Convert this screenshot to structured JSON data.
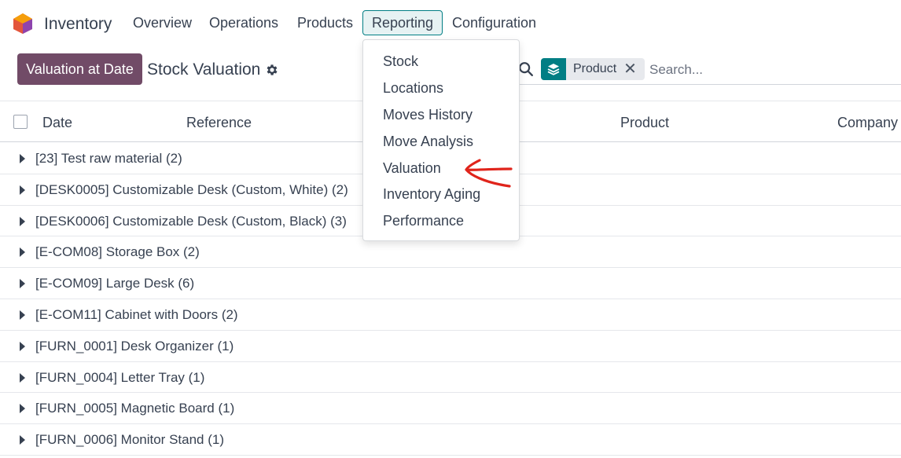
{
  "app": {
    "name": "Inventory",
    "brand_color": "#714b67",
    "accent_color": "#017e84"
  },
  "nav": {
    "items": [
      {
        "label": "Overview"
      },
      {
        "label": "Operations"
      },
      {
        "label": "Products"
      },
      {
        "label": "Reporting",
        "active": true
      },
      {
        "label": "Configuration"
      }
    ]
  },
  "reporting_menu": {
    "items": [
      {
        "label": "Stock"
      },
      {
        "label": "Locations"
      },
      {
        "label": "Moves History"
      },
      {
        "label": "Move Analysis"
      },
      {
        "label": "Valuation"
      },
      {
        "label": "Inventory Aging"
      },
      {
        "label": "Performance"
      }
    ]
  },
  "control_panel": {
    "primary_button": "Valuation at Date",
    "title": "Stock Valuation",
    "settings_icon": "gear-icon"
  },
  "search": {
    "facet_icon": "layers-icon",
    "facet_label": "Product",
    "facet_close": "✕",
    "placeholder": "Search..."
  },
  "table": {
    "columns": [
      "Date",
      "Reference",
      "Product",
      "Company"
    ],
    "groups": [
      {
        "label": "[23] Test raw material (2)"
      },
      {
        "label": "[DESK0005] Customizable Desk (Custom, White) (2)"
      },
      {
        "label": "[DESK0006] Customizable Desk (Custom, Black) (3)"
      },
      {
        "label": "[E-COM08] Storage Box (2)"
      },
      {
        "label": "[E-COM09] Large Desk (6)"
      },
      {
        "label": "[E-COM11] Cabinet with Doors (2)"
      },
      {
        "label": "[FURN_0001] Desk Organizer (1)"
      },
      {
        "label": "[FURN_0004] Letter Tray (1)"
      },
      {
        "label": "[FURN_0005] Magnetic Board (1)"
      },
      {
        "label": "[FURN_0006] Monitor Stand (1)"
      }
    ]
  }
}
